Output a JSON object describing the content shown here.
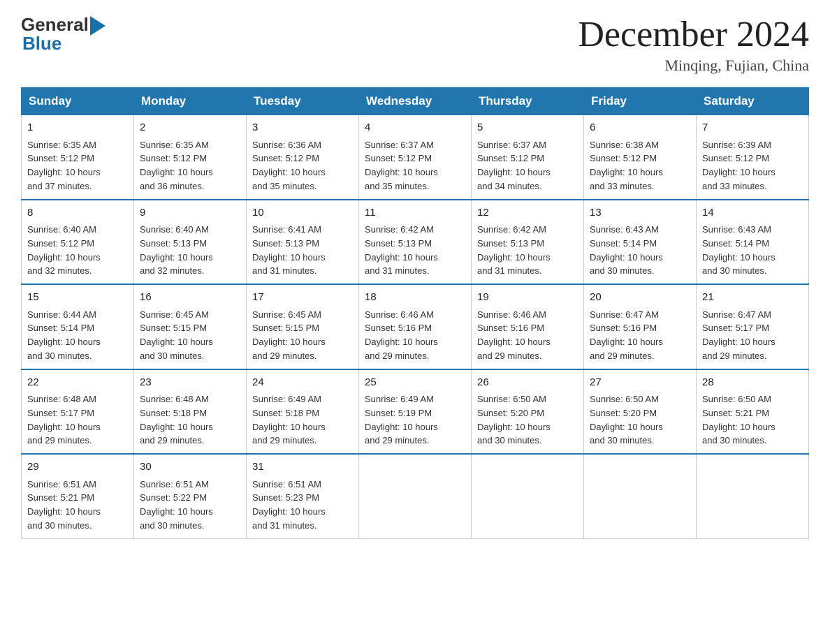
{
  "header": {
    "logo_general": "General",
    "logo_blue": "Blue",
    "month_title": "December 2024",
    "location": "Minqing, Fujian, China"
  },
  "days_of_week": [
    "Sunday",
    "Monday",
    "Tuesday",
    "Wednesday",
    "Thursday",
    "Friday",
    "Saturday"
  ],
  "weeks": [
    [
      {
        "num": "1",
        "sunrise": "6:35 AM",
        "sunset": "5:12 PM",
        "daylight": "10 hours and 37 minutes."
      },
      {
        "num": "2",
        "sunrise": "6:35 AM",
        "sunset": "5:12 PM",
        "daylight": "10 hours and 36 minutes."
      },
      {
        "num": "3",
        "sunrise": "6:36 AM",
        "sunset": "5:12 PM",
        "daylight": "10 hours and 35 minutes."
      },
      {
        "num": "4",
        "sunrise": "6:37 AM",
        "sunset": "5:12 PM",
        "daylight": "10 hours and 35 minutes."
      },
      {
        "num": "5",
        "sunrise": "6:37 AM",
        "sunset": "5:12 PM",
        "daylight": "10 hours and 34 minutes."
      },
      {
        "num": "6",
        "sunrise": "6:38 AM",
        "sunset": "5:12 PM",
        "daylight": "10 hours and 33 minutes."
      },
      {
        "num": "7",
        "sunrise": "6:39 AM",
        "sunset": "5:12 PM",
        "daylight": "10 hours and 33 minutes."
      }
    ],
    [
      {
        "num": "8",
        "sunrise": "6:40 AM",
        "sunset": "5:12 PM",
        "daylight": "10 hours and 32 minutes."
      },
      {
        "num": "9",
        "sunrise": "6:40 AM",
        "sunset": "5:13 PM",
        "daylight": "10 hours and 32 minutes."
      },
      {
        "num": "10",
        "sunrise": "6:41 AM",
        "sunset": "5:13 PM",
        "daylight": "10 hours and 31 minutes."
      },
      {
        "num": "11",
        "sunrise": "6:42 AM",
        "sunset": "5:13 PM",
        "daylight": "10 hours and 31 minutes."
      },
      {
        "num": "12",
        "sunrise": "6:42 AM",
        "sunset": "5:13 PM",
        "daylight": "10 hours and 31 minutes."
      },
      {
        "num": "13",
        "sunrise": "6:43 AM",
        "sunset": "5:14 PM",
        "daylight": "10 hours and 30 minutes."
      },
      {
        "num": "14",
        "sunrise": "6:43 AM",
        "sunset": "5:14 PM",
        "daylight": "10 hours and 30 minutes."
      }
    ],
    [
      {
        "num": "15",
        "sunrise": "6:44 AM",
        "sunset": "5:14 PM",
        "daylight": "10 hours and 30 minutes."
      },
      {
        "num": "16",
        "sunrise": "6:45 AM",
        "sunset": "5:15 PM",
        "daylight": "10 hours and 30 minutes."
      },
      {
        "num": "17",
        "sunrise": "6:45 AM",
        "sunset": "5:15 PM",
        "daylight": "10 hours and 29 minutes."
      },
      {
        "num": "18",
        "sunrise": "6:46 AM",
        "sunset": "5:16 PM",
        "daylight": "10 hours and 29 minutes."
      },
      {
        "num": "19",
        "sunrise": "6:46 AM",
        "sunset": "5:16 PM",
        "daylight": "10 hours and 29 minutes."
      },
      {
        "num": "20",
        "sunrise": "6:47 AM",
        "sunset": "5:16 PM",
        "daylight": "10 hours and 29 minutes."
      },
      {
        "num": "21",
        "sunrise": "6:47 AM",
        "sunset": "5:17 PM",
        "daylight": "10 hours and 29 minutes."
      }
    ],
    [
      {
        "num": "22",
        "sunrise": "6:48 AM",
        "sunset": "5:17 PM",
        "daylight": "10 hours and 29 minutes."
      },
      {
        "num": "23",
        "sunrise": "6:48 AM",
        "sunset": "5:18 PM",
        "daylight": "10 hours and 29 minutes."
      },
      {
        "num": "24",
        "sunrise": "6:49 AM",
        "sunset": "5:18 PM",
        "daylight": "10 hours and 29 minutes."
      },
      {
        "num": "25",
        "sunrise": "6:49 AM",
        "sunset": "5:19 PM",
        "daylight": "10 hours and 29 minutes."
      },
      {
        "num": "26",
        "sunrise": "6:50 AM",
        "sunset": "5:20 PM",
        "daylight": "10 hours and 30 minutes."
      },
      {
        "num": "27",
        "sunrise": "6:50 AM",
        "sunset": "5:20 PM",
        "daylight": "10 hours and 30 minutes."
      },
      {
        "num": "28",
        "sunrise": "6:50 AM",
        "sunset": "5:21 PM",
        "daylight": "10 hours and 30 minutes."
      }
    ],
    [
      {
        "num": "29",
        "sunrise": "6:51 AM",
        "sunset": "5:21 PM",
        "daylight": "10 hours and 30 minutes."
      },
      {
        "num": "30",
        "sunrise": "6:51 AM",
        "sunset": "5:22 PM",
        "daylight": "10 hours and 30 minutes."
      },
      {
        "num": "31",
        "sunrise": "6:51 AM",
        "sunset": "5:23 PM",
        "daylight": "10 hours and 31 minutes."
      },
      null,
      null,
      null,
      null
    ]
  ],
  "labels": {
    "sunrise": "Sunrise:",
    "sunset": "Sunset:",
    "daylight": "Daylight:"
  }
}
